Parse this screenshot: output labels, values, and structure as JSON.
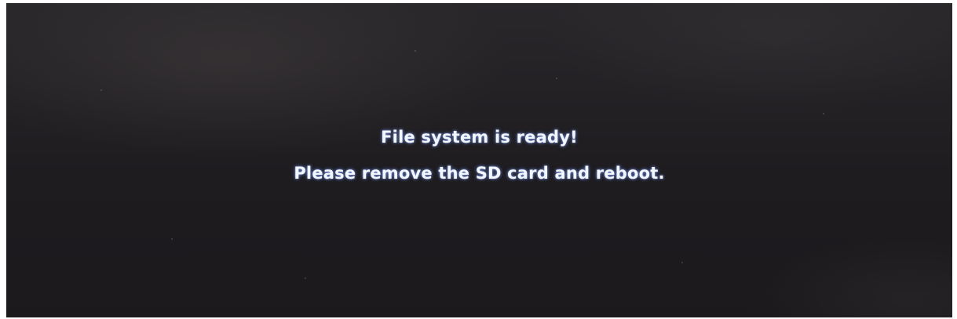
{
  "screen": {
    "line1": "File system is ready!",
    "line2": "Please remove the SD card and reboot."
  }
}
